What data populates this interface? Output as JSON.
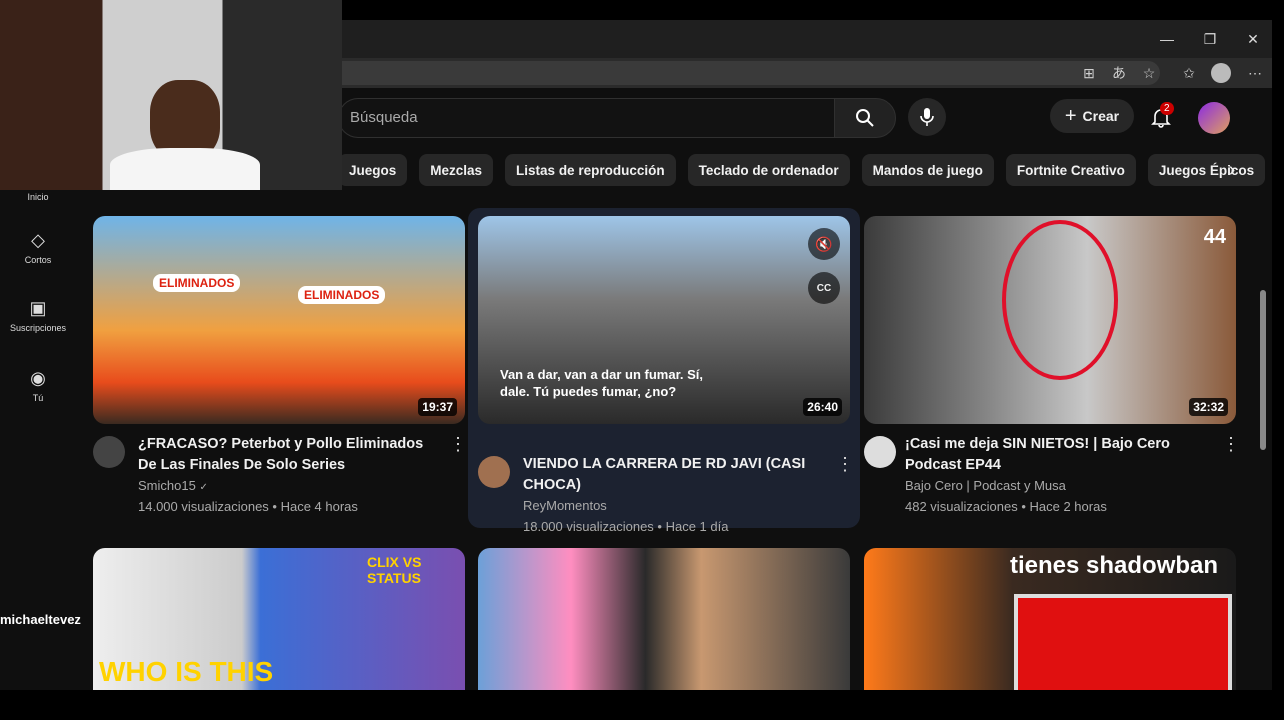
{
  "window": {
    "minimize": "—",
    "restore": "❐",
    "close": "✕"
  },
  "toolbar": {
    "icons": [
      "grid-icon",
      "translate-icon",
      "star-icon",
      "favorites-icon",
      "profile-icon",
      "more-icon"
    ]
  },
  "header": {
    "search_placeholder": "Búsqueda",
    "create_label": "Crear",
    "notification_count": "2"
  },
  "chips": [
    "Juegos",
    "Mezclas",
    "Listas de reproducción",
    "Teclado de ordenador",
    "Mandos de juego",
    "Fortnite Creativo",
    "Juegos Épicos"
  ],
  "sidebar": {
    "items": [
      {
        "label": "Inicio",
        "icon": "home-icon"
      },
      {
        "label": "Cortos",
        "icon": "shorts-icon"
      },
      {
        "label": "Suscripciones",
        "icon": "subscriptions-icon"
      },
      {
        "label": "Tú",
        "icon": "you-icon"
      }
    ]
  },
  "videos": [
    {
      "title": "¿FRACASO? Peterbot y Pollo Eliminados De Las Finales De Solo Series",
      "channel": "Smicho15",
      "verified": "✓",
      "meta": "14.000 visualizaciones • Hace 4 horas",
      "duration": "19:37",
      "overlay1": "ELIMINADOS",
      "overlay2": "ELIMINADOS"
    },
    {
      "title": "VIENDO LA CARRERA DE RD JAVI (CASI CHOCA)",
      "channel": "ReyMomentos",
      "meta": "18.000 visualizaciones • Hace 1 día",
      "duration": "26:40",
      "caption": "Van a dar, van a dar un fumar. Sí, dale. Tú puedes fumar, ¿no?",
      "cc": "CC"
    },
    {
      "title": "¡Casi me deja SIN NIETOS! | Bajo Cero Podcast EP44",
      "channel": "Bajo Cero | Podcast y Musa",
      "meta": "482 visualizaciones • Hace 2 horas",
      "duration": "32:32",
      "corner": "44"
    },
    {
      "overlay": "WHO IS THIS",
      "overlay2": "CLIX VS STATUS"
    },
    {},
    {
      "overlay": "tienes shadowban"
    }
  ],
  "overlay_name": "michaeltevez"
}
